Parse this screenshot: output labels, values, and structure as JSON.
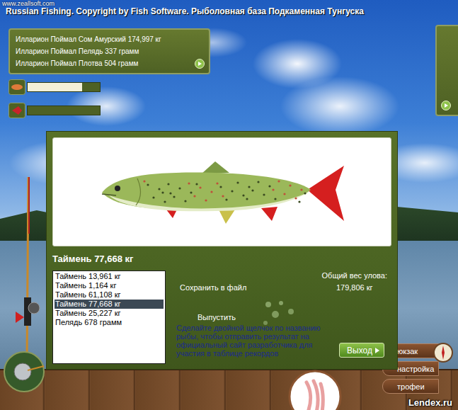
{
  "window": {
    "title": "Russian Fishing. Copyright by Fish Software. Рыболовная база Подкаменная Тунгуска"
  },
  "watermarks": {
    "top": "www.zeallsoft.com",
    "bottom": "Lendex.ru"
  },
  "log": [
    "Илларион Поймал Сом Амурский 174,997 кг",
    "Илларион Поймал Пелядь 337 грамм",
    "Илларион Поймал Плотва 504 грамм"
  ],
  "meters": [
    {
      "name": "bait",
      "level": 0.75
    },
    {
      "name": "fish",
      "level": 0.0
    }
  ],
  "catch": {
    "title": "Таймень 77,668 кг",
    "items": [
      {
        "label": "Таймень 13,961 кг",
        "selected": false
      },
      {
        "label": "Таймень 1,164 кг",
        "selected": false
      },
      {
        "label": "Таймень 61,108 кг",
        "selected": false
      },
      {
        "label": "Таймень 77,668 кг",
        "selected": true
      },
      {
        "label": "Таймень 25,227 кг",
        "selected": false
      },
      {
        "label": "Пелядь 678 грамм",
        "selected": false
      }
    ],
    "total_label": "Общий вес улова:",
    "total": "179,806 кг",
    "save": "Сохранить в файл",
    "release": "Выпустить",
    "hint": "Сделайте двойной щелчок по названию рыбы, чтобы отправить результат на официальный сайт разработчика для участия в таблице рекордов",
    "exit": "Выход"
  },
  "menu": [
    {
      "label": "юкзак"
    },
    {
      "label": "настройка"
    },
    {
      "label": "трофеи"
    }
  ]
}
